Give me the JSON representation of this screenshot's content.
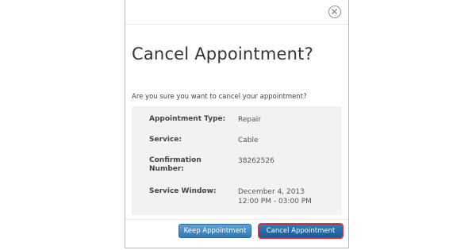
{
  "dialog": {
    "title": "Cancel Appointment?",
    "prompt": "Are you sure you want to cancel your appointment?",
    "close_icon": "close-circle-icon",
    "details": [
      {
        "label": "Appointment Type:",
        "value": "Repair"
      },
      {
        "label": "Service:",
        "value": "Cable"
      },
      {
        "label": "Confirmation Number:",
        "value": "38262526"
      },
      {
        "label": "Service Window:",
        "value": "December 4, 2013 12:00 PM - 03:00 PM"
      }
    ],
    "buttons": {
      "keep_label": "Keep Appointment",
      "cancel_label": "Cancel Appointment"
    }
  },
  "colors": {
    "button_blue": "#2f78b5",
    "focus_outline": "#d43a44",
    "details_background": "#f2f2f2"
  }
}
